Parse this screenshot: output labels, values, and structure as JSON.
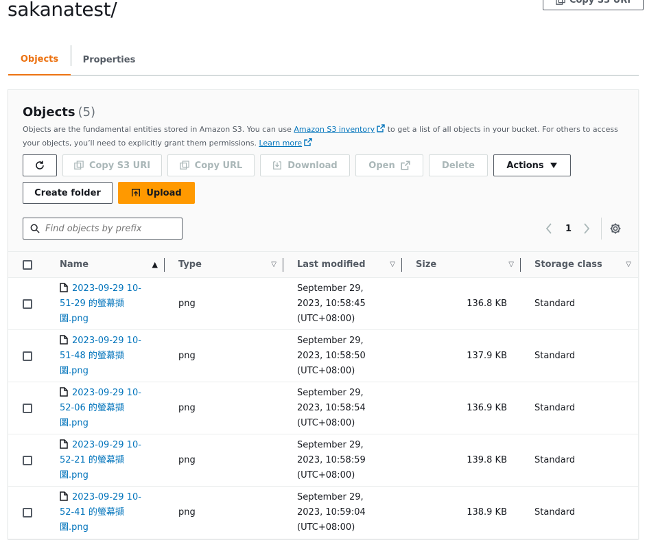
{
  "page": {
    "title": "sakanatest/",
    "copy_s3_uri_top": "Copy S3 URI"
  },
  "tabs": [
    {
      "label": "Objects"
    },
    {
      "label": "Properties"
    }
  ],
  "objects_panel": {
    "title": "Objects",
    "count": "(5)",
    "desc_part1": "Objects are the fundamental entities stored in Amazon S3. You can use ",
    "desc_link1": "Amazon S3 inventory",
    "desc_part2": " to get a list of all objects in your bucket. For others to access your objects, you’ll need to explicitly grant them permissions. ",
    "desc_link2": "Learn more"
  },
  "toolbar": {
    "copy_s3_uri": "Copy S3 URI",
    "copy_url": "Copy URL",
    "download": "Download",
    "open": "Open",
    "delete": "Delete",
    "actions": "Actions",
    "create_folder": "Create folder",
    "upload": "Upload"
  },
  "search": {
    "placeholder": "Find objects by prefix"
  },
  "pagination": {
    "current_page": "1"
  },
  "table": {
    "headers": {
      "name": "Name",
      "type": "Type",
      "last_modified": "Last modified",
      "size": "Size",
      "storage_class": "Storage class"
    },
    "rows": [
      {
        "name_l1": "2023-09-29 10-",
        "name_l2": "51-29 的螢幕擷",
        "name_l3": "圖.png",
        "type": "png",
        "date_l1": "September 29,",
        "date_l2": "2023, 10:58:45",
        "date_l3": "(UTC+08:00)",
        "size": "136.8 KB",
        "storage_class": "Standard"
      },
      {
        "name_l1": "2023-09-29 10-",
        "name_l2": "51-48 的螢幕擷",
        "name_l3": "圖.png",
        "type": "png",
        "date_l1": "September 29,",
        "date_l2": "2023, 10:58:50",
        "date_l3": "(UTC+08:00)",
        "size": "137.9 KB",
        "storage_class": "Standard"
      },
      {
        "name_l1": "2023-09-29 10-",
        "name_l2": "52-06 的螢幕擷",
        "name_l3": "圖.png",
        "type": "png",
        "date_l1": "September 29,",
        "date_l2": "2023, 10:58:54",
        "date_l3": "(UTC+08:00)",
        "size": "136.9 KB",
        "storage_class": "Standard"
      },
      {
        "name_l1": "2023-09-29 10-",
        "name_l2": "52-21 的螢幕擷",
        "name_l3": "圖.png",
        "type": "png",
        "date_l1": "September 29,",
        "date_l2": "2023, 10:58:59",
        "date_l3": "(UTC+08:00)",
        "size": "139.8 KB",
        "storage_class": "Standard"
      },
      {
        "name_l1": "2023-09-29 10-",
        "name_l2": "52-41 的螢幕擷",
        "name_l3": "圖.png",
        "type": "png",
        "date_l1": "September 29,",
        "date_l2": "2023, 10:59:04",
        "date_l3": "(UTC+08:00)",
        "size": "138.9 KB",
        "storage_class": "Standard"
      }
    ]
  },
  "colors": {
    "accent_orange": "#ec7211",
    "upload_orange": "#ff9900",
    "link_blue": "#0073bb"
  }
}
